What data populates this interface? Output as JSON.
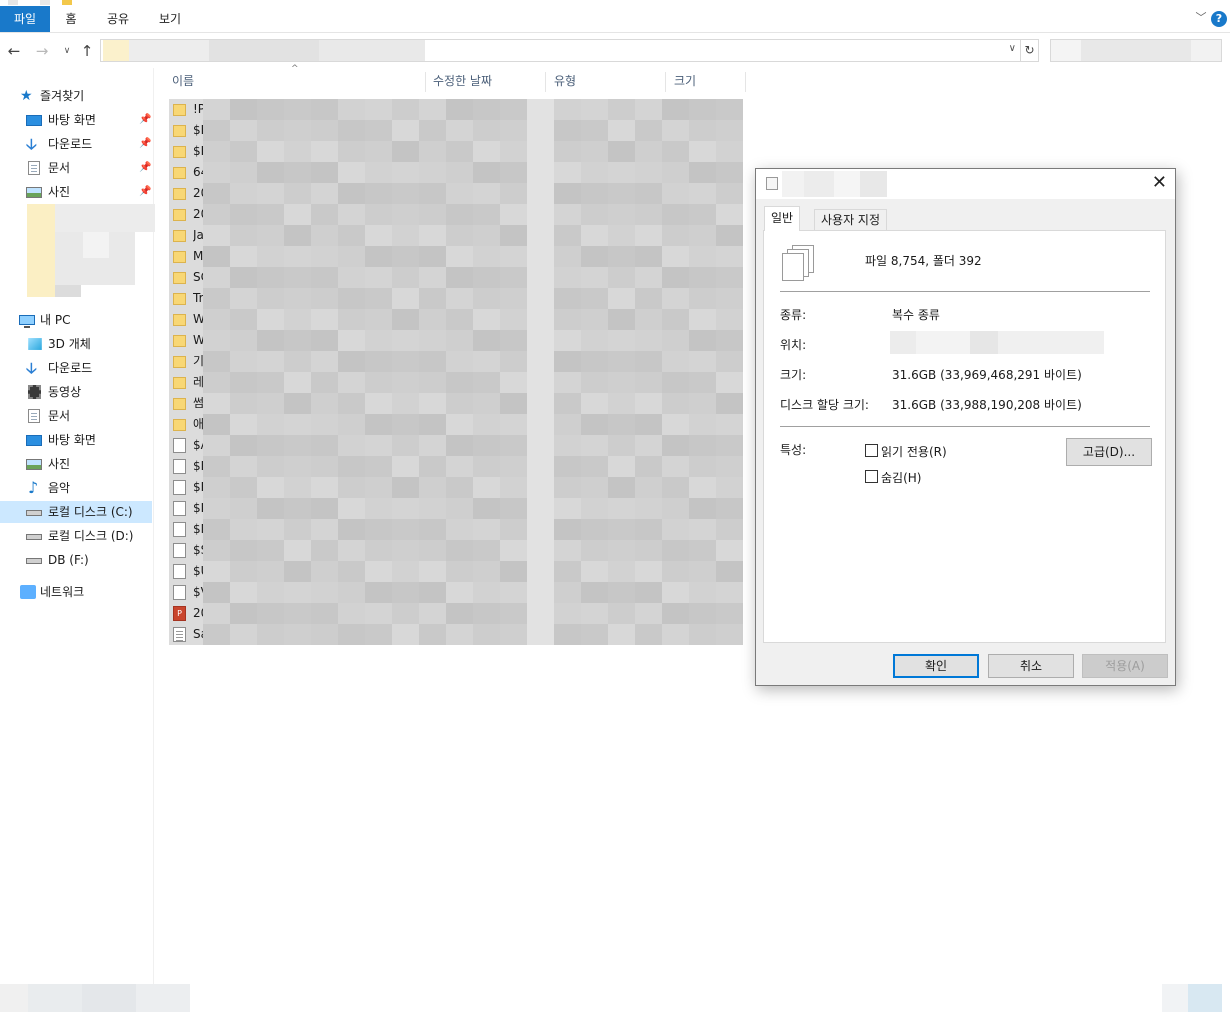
{
  "ribbon": {
    "tabs": [
      "파일",
      "홈",
      "공유",
      "보기"
    ],
    "help_glyph": "?"
  },
  "nav": {
    "quick_access": "즐겨찾기",
    "pinned": [
      "바탕 화면",
      "다운로드",
      "문서",
      "사진"
    ],
    "this_pc": "내 PC",
    "pc_items": [
      "3D 개체",
      "다운로드",
      "동영상",
      "문서",
      "바탕 화면",
      "사진",
      "음악",
      "로컬 디스크 (C:)",
      "로컬 디스크 (D:)",
      "DB (F:)"
    ],
    "network": "네트워크",
    "selected": "로컬 디스크 (C:)"
  },
  "columns": [
    "이름",
    "수정한 날짜",
    "유형",
    "크기"
  ],
  "files": [
    {
      "name": "!P",
      "kind": "folder"
    },
    {
      "name": "$E",
      "kind": "folder"
    },
    {
      "name": "$F",
      "kind": "folder"
    },
    {
      "name": "64",
      "kind": "folder"
    },
    {
      "name": "20",
      "kind": "folder"
    },
    {
      "name": "20",
      "kind": "folder"
    },
    {
      "name": "Ja",
      "kind": "folder"
    },
    {
      "name": "M",
      "kind": "folder"
    },
    {
      "name": "SC",
      "kind": "folder"
    },
    {
      "name": "Tr",
      "kind": "folder"
    },
    {
      "name": "W",
      "kind": "folder"
    },
    {
      "name": "W",
      "kind": "folder"
    },
    {
      "name": "기",
      "kind": "folder"
    },
    {
      "name": "레",
      "kind": "folder"
    },
    {
      "name": "썸",
      "kind": "folder"
    },
    {
      "name": "애",
      "kind": "folder"
    },
    {
      "name": "$A",
      "kind": "file"
    },
    {
      "name": "$E",
      "kind": "file"
    },
    {
      "name": "$E",
      "kind": "file"
    },
    {
      "name": "$L",
      "kind": "file"
    },
    {
      "name": "$N",
      "kind": "file"
    },
    {
      "name": "$S",
      "kind": "file"
    },
    {
      "name": "$U",
      "kind": "file"
    },
    {
      "name": "$V",
      "kind": "file"
    },
    {
      "name": "20",
      "kind": "ppt"
    },
    {
      "name": "Sa",
      "kind": "txt"
    }
  ],
  "dialog": {
    "tabs": [
      "일반",
      "사용자 지정"
    ],
    "summary": "파일 8,754, 폴더 392",
    "type_label": "종류:",
    "type_value": "복수 종류",
    "location_label": "위치:",
    "size_label": "크기:",
    "size_value": "31.6GB (33,969,468,291 바이트)",
    "disk_label": "디스크 할당 크기:",
    "disk_value": "31.6GB (33,988,190,208 바이트)",
    "attr_label": "특성:",
    "readonly": "읽기 전용(R)",
    "hidden": "숨김(H)",
    "advanced": "고급(D)...",
    "ok": "확인",
    "cancel": "취소",
    "apply": "적용(A)",
    "close_glyph": "✕"
  }
}
